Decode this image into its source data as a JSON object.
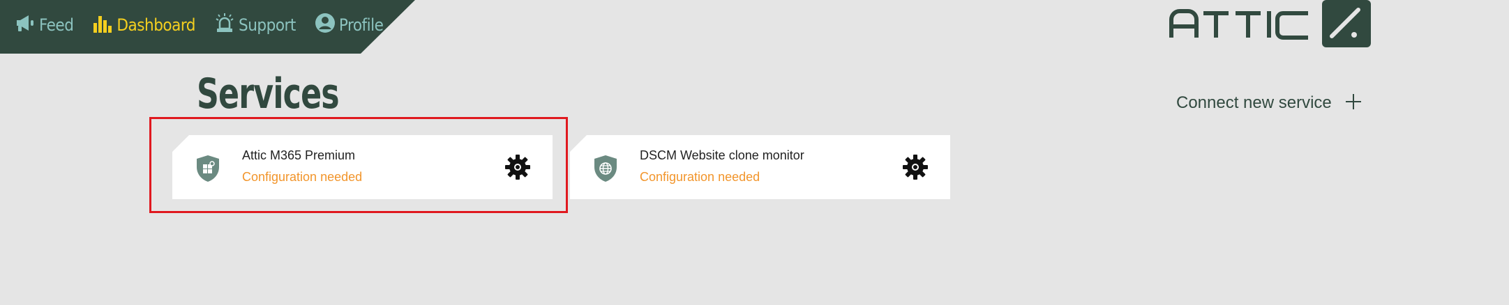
{
  "nav": {
    "items": [
      {
        "label": "Feed",
        "icon": "megaphone-icon",
        "active": false
      },
      {
        "label": "Dashboard",
        "icon": "bar-chart-icon",
        "active": true
      },
      {
        "label": "Support",
        "icon": "siren-icon",
        "active": false
      },
      {
        "label": "Profile",
        "icon": "user-circle-icon",
        "active": false
      }
    ]
  },
  "brand": {
    "name": "ATTIC",
    "colors": {
      "primary": "#31493f",
      "accent": "#f4cf1f",
      "nav_text": "#8cc3bf",
      "warning": "#f2952b"
    }
  },
  "page": {
    "title": "Services",
    "connect_label": "Connect new service"
  },
  "services": [
    {
      "name": "Attic M365 Premium",
      "status": "Configuration needed",
      "icon": "shield-windows-icon"
    },
    {
      "name": "DSCM Website clone monitor",
      "status": "Configuration needed",
      "icon": "shield-globe-icon"
    }
  ]
}
